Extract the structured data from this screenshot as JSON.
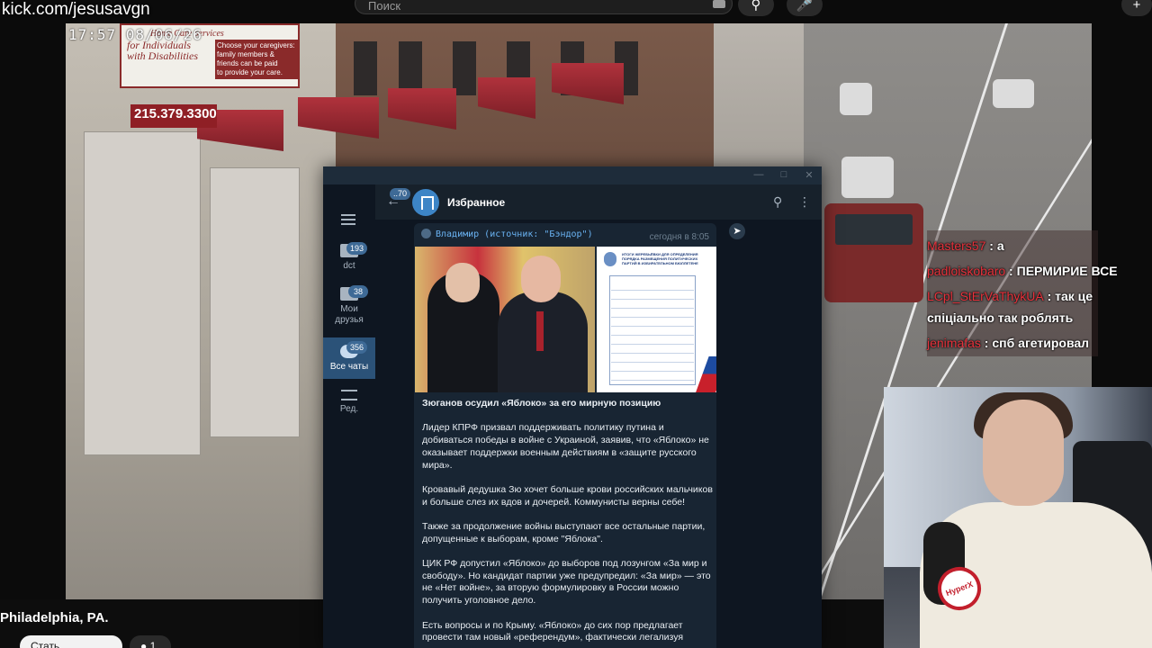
{
  "stream": {
    "url": "kick.com/jesusavgn",
    "timestamp": "17:57 08/06/26",
    "location": "Philadelphia, PA.",
    "bottom_button": "Стать спонсором",
    "bottom_count": "1"
  },
  "top_search": {
    "placeholder": "Поиск",
    "plus": "+"
  },
  "scene_text": {
    "sign_lines": [
      "Home Care Services",
      "for Individuals",
      "with Disabilities",
      "Choose your caregivers:",
      "family members &",
      "friends can be paid",
      "to provide your care."
    ],
    "phone": "215.379.3300"
  },
  "chat": [
    {
      "nick": "Masters57",
      "text": "а"
    },
    {
      "nick": "padloiskobaro",
      "text": "ПЕРМИРИЕ ВСЕ"
    },
    {
      "nick": "LCpl_StErVaThykUA",
      "text": "так це"
    },
    {
      "nick": "",
      "text": "спiцiально так роблять"
    },
    {
      "nick": "jenimafas",
      "text": "спб агетировал"
    }
  ],
  "mic_badge": "HyperX",
  "telegram": {
    "sidebar": [
      {
        "label": "dct",
        "badge": "193"
      },
      {
        "label": "Мои друзья",
        "badge": "38"
      },
      {
        "label": "Все чаты",
        "badge": "356"
      },
      {
        "label": "Ред.",
        "badge": ""
      }
    ],
    "back_badge": "70",
    "chat_title": "Избранное",
    "message": {
      "forward_from": "Владимир (источник: \"Бэндор\")",
      "time": "сегодня в 8:05",
      "doc_heading": "ИТОГИ ЖЕРЕБЬЁВКИ ДЛЯ ОПРЕДЕЛЕНИЯ ПОРЯДКА РАЗМЕЩЕНИЯ ПОЛИТИЧЕСКИХ ПАРТИЙ В ИЗБИРАТЕЛЬНОМ БЮЛЛЕТЕНЕ",
      "headline": "Зюганов осудил «Яблоко» за его мирную позицию",
      "paragraphs": [
        "Лидер КПРФ призвал поддерживать политику путина и добиваться победы в войне с Украиной, заявив, что «Яблоко» не оказывает поддержки военным действиям в «защите русского мира».",
        "Кровавый дедушка Зю хочет больше крови российских мальчиков и больше слез их вдов и дочерей. Коммунисты верны себе!",
        "Также за продолжение войны выступают все остальные партии, допущенные к выборам, кроме \"Яблока\".",
        "ЦИК РФ допустил «Яблоко» до выборов под лозунгом «За мир и свободу». Но кандидат партии уже предупредил: «За мир» — это не «Нет войне», за вторую формулировку в России можно получить уголовное дело.",
        "Есть вопросы и по Крыму. «Яблоко» до сих пор предлагает провести там новый «референдум», фактически легализуя"
      ]
    }
  },
  "colors": {
    "tg_bg": "#17212b",
    "tg_dark": "#0e1621",
    "tg_bubble": "#182533",
    "tg_accent": "#2b5278",
    "link": "#6ab3f3",
    "chat_nick": "#e7323c"
  }
}
